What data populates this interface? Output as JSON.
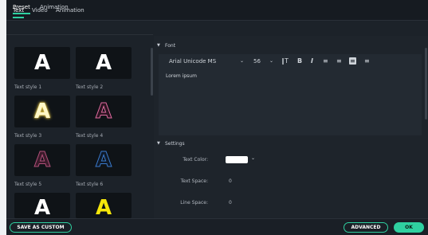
{
  "top_tabs": [
    {
      "label": "Text"
    },
    {
      "label": "Video"
    },
    {
      "label": "Animation"
    }
  ],
  "sub_tabs": [
    {
      "label": "Preset"
    },
    {
      "label": "Animation"
    }
  ],
  "text_styles": [
    {
      "label": "Text style 1",
      "letter": "A"
    },
    {
      "label": "Text style 2",
      "letter": "A"
    },
    {
      "label": "Text style 3",
      "letter": "A"
    },
    {
      "label": "Text style 4",
      "letter": "A"
    },
    {
      "label": "Text style 5",
      "letter": "A"
    },
    {
      "label": "Text style 6",
      "letter": "A"
    },
    {
      "label": "",
      "letter": "A"
    },
    {
      "label": "",
      "letter": "A"
    }
  ],
  "font_section": {
    "title": "Font",
    "font_name": "Arial Unicode MS",
    "font_size": "56",
    "bold": "B",
    "italic": "I",
    "text": "Lorem ipsum"
  },
  "settings_section": {
    "title": "Settings",
    "text_color_label": "Text Color:",
    "text_color": "#ffffff",
    "text_space_label": "Text Space:",
    "text_space": "0",
    "line_space_label": "Line Space:",
    "line_space": "0"
  },
  "buttons": {
    "save": "SAVE AS CUSTOM",
    "advanced": "ADVANCED",
    "ok": "OK"
  },
  "colors": {
    "accent": "#2fd0a0",
    "background": "#1c2229"
  }
}
